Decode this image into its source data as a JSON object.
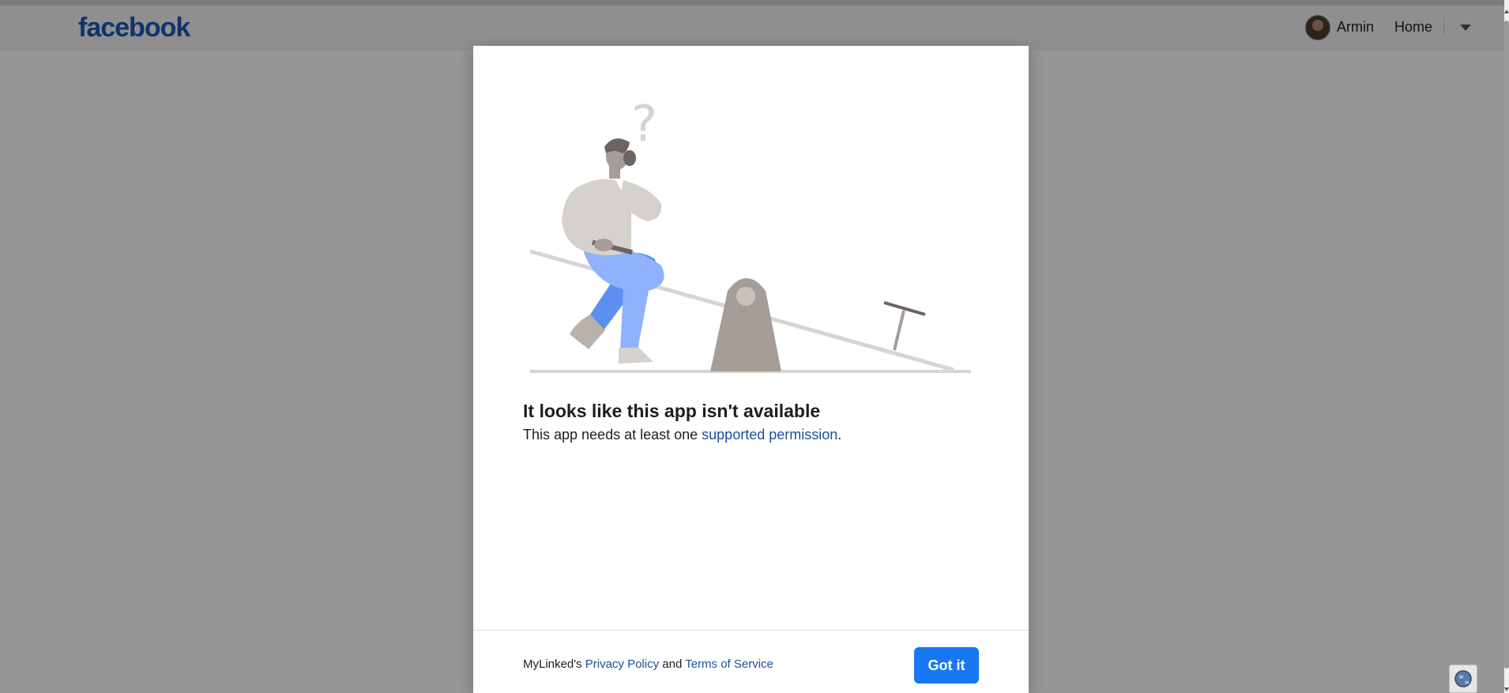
{
  "header": {
    "logo": "facebook",
    "user_name": "Armin",
    "home_label": "Home"
  },
  "dialog": {
    "title": "It looks like this app isn't available",
    "message_prefix": "This app needs at least one ",
    "message_link": "supported permission",
    "message_suffix": ".",
    "footer": {
      "app_prefix": "MyLinked's ",
      "privacy_link": "Privacy Policy",
      "and_text": " and ",
      "terms_link": "Terms of Service"
    },
    "confirm_label": "Got it"
  },
  "icons": {
    "avatar": "user-avatar",
    "caret": "chevron-down-icon",
    "globe": "globe-icon",
    "illustration": "confused-person-on-seesaw"
  },
  "colors": {
    "brand": "#1d56b8",
    "button": "#1877f2",
    "link": "#1a4fa0"
  }
}
